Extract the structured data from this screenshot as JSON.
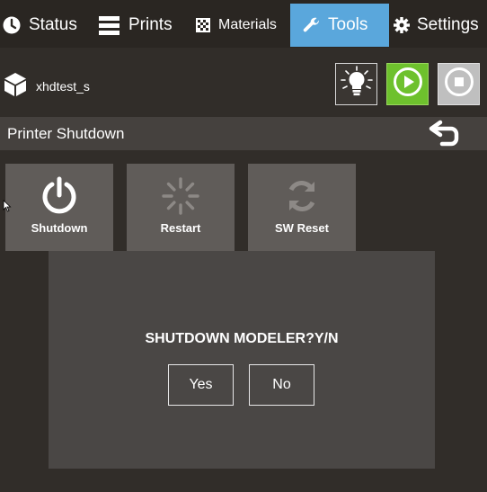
{
  "tabs": [
    {
      "label": "Status",
      "icon": "clock-icon"
    },
    {
      "label": "Prints",
      "icon": "list-icon"
    },
    {
      "label": "Materials",
      "icon": "materials-grid-icon"
    },
    {
      "label": "Tools",
      "icon": "wrench-icon",
      "active": true
    },
    {
      "label": "Settings",
      "icon": "gear-icon"
    }
  ],
  "printer": {
    "name": "xhdtest_s",
    "icon": "cube-icon"
  },
  "controls": [
    {
      "name": "light-button",
      "icon": "lightbulb-icon"
    },
    {
      "name": "play-button",
      "icon": "play-icon",
      "color": "#6ec12d"
    },
    {
      "name": "stop-button",
      "icon": "stop-icon"
    }
  ],
  "section": {
    "title": "Printer Shutdown",
    "back_icon": "back-arrow-icon"
  },
  "tiles": [
    {
      "label": "Shutdown",
      "icon": "power-icon"
    },
    {
      "label": "Restart",
      "icon": "spinner-icon"
    },
    {
      "label": "SW Reset",
      "icon": "refresh-icon"
    }
  ],
  "dialog": {
    "question": "SHUTDOWN MODELER?Y/N",
    "yes_label": "Yes",
    "no_label": "No"
  },
  "colors": {
    "accent": "#5aa7dc",
    "play": "#6ec12d",
    "background": "#312d29"
  }
}
